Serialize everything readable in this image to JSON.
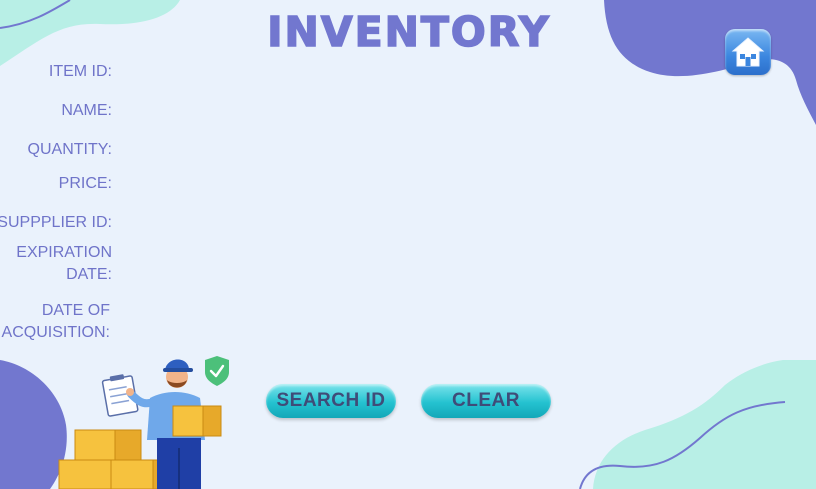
{
  "header": {
    "title": "INVENTORY",
    "home_icon": "home-icon"
  },
  "form": {
    "fields": [
      {
        "label": "ITEM ID:",
        "value": ""
      },
      {
        "label": "NAME:",
        "value": ""
      },
      {
        "label": "QUANTITY:",
        "value": ""
      },
      {
        "label": "PRICE:",
        "value": ""
      },
      {
        "label": "SUPPPLIER ID:",
        "value": ""
      },
      {
        "label": "EXPIRATION DATE:",
        "value": ""
      },
      {
        "label": "DATE OF ACQUISITION:",
        "value": ""
      }
    ]
  },
  "actions": {
    "search_label": "SEARCH ID",
    "clear_label": "CLEAR"
  },
  "colors": {
    "background": "#eaf2fc",
    "accent_purple": "#7277cf",
    "accent_mint": "#b8efe6",
    "button_teal": "#24c2d0",
    "label_color": "#6f74c9"
  },
  "illustration": {
    "name": "delivery-worker-with-boxes-illustration"
  }
}
